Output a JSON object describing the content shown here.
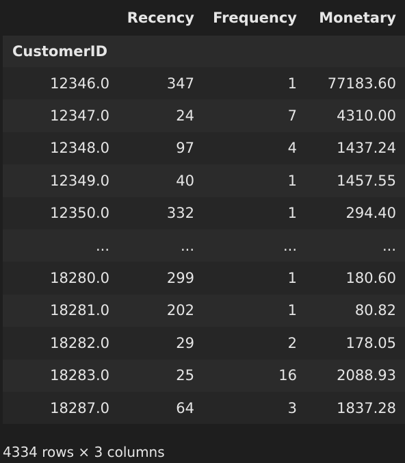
{
  "table": {
    "columns": [
      "Recency",
      "Frequency",
      "Monetary"
    ],
    "index_name": "CustomerID",
    "rows": [
      [
        "12346.0",
        "347",
        "1",
        "77183.60"
      ],
      [
        "12347.0",
        "24",
        "7",
        "4310.00"
      ],
      [
        "12348.0",
        "97",
        "4",
        "1437.24"
      ],
      [
        "12349.0",
        "40",
        "1",
        "1457.55"
      ],
      [
        "12350.0",
        "332",
        "1",
        "294.40"
      ],
      [
        "...",
        "...",
        "...",
        "..."
      ],
      [
        "18280.0",
        "299",
        "1",
        "180.60"
      ],
      [
        "18281.0",
        "202",
        "1",
        "80.82"
      ],
      [
        "18282.0",
        "29",
        "2",
        "178.05"
      ],
      [
        "18283.0",
        "25",
        "16",
        "2088.93"
      ],
      [
        "18287.0",
        "64",
        "3",
        "1837.28"
      ]
    ]
  },
  "footer": {
    "shape_text": "4334 rows × 3 columns"
  }
}
